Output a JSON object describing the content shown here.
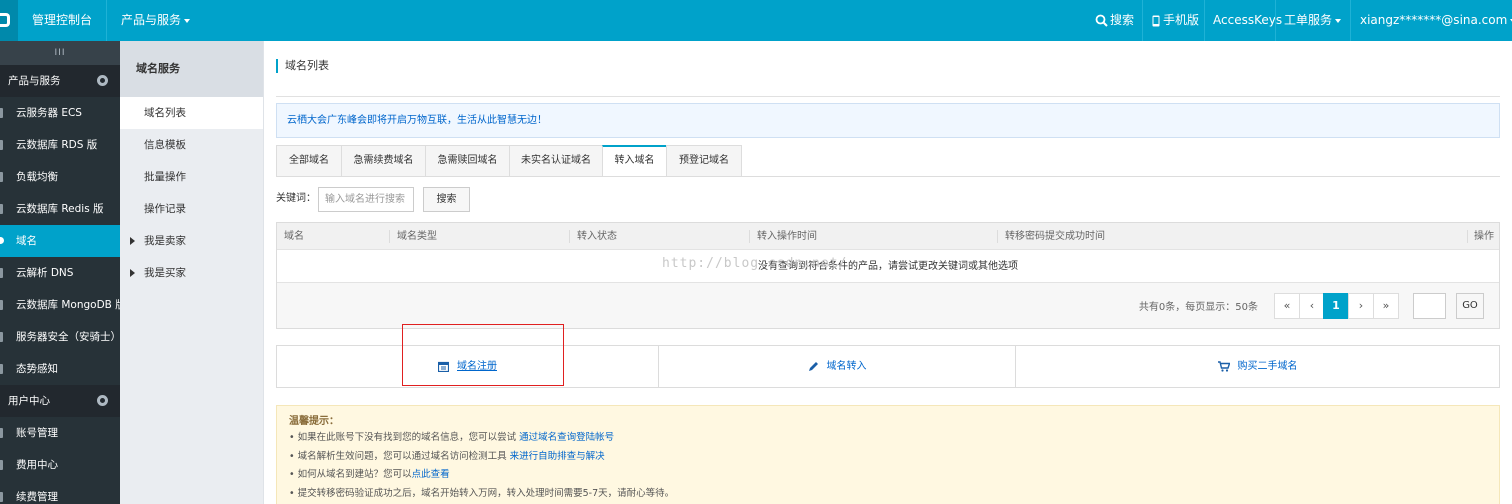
{
  "topbar": {
    "console": "管理控制台",
    "products": "产品与服务",
    "search": "搜索",
    "mobile": "手机版",
    "accesskeys": "AccessKeys",
    "tickets": "工单服务",
    "user": "xiangz*******@sina.com",
    "accent_color": "#00a2ca"
  },
  "sidebar": {
    "toggle": "III",
    "section1": "产品与服务",
    "items": [
      {
        "label": "云服务器 ECS"
      },
      {
        "label": "云数据库 RDS 版"
      },
      {
        "label": "负载均衡"
      },
      {
        "label": "云数据库 Redis 版"
      },
      {
        "label": "域名",
        "active": true
      },
      {
        "label": "云解析 DNS"
      },
      {
        "label": "云数据库 MongoDB 版"
      },
      {
        "label": "服务器安全（安骑士）"
      },
      {
        "label": "态势感知"
      }
    ],
    "section2": "用户中心",
    "items2": [
      {
        "label": "账号管理"
      },
      {
        "label": "费用中心"
      },
      {
        "label": "续费管理"
      }
    ]
  },
  "subnav": {
    "title": "域名服务",
    "items": [
      {
        "label": "域名列表",
        "active": true
      },
      {
        "label": "信息模板"
      },
      {
        "label": "批量操作"
      },
      {
        "label": "操作记录"
      },
      {
        "label": "我是卖家",
        "expandable": true
      },
      {
        "label": "我是买家",
        "expandable": true
      }
    ]
  },
  "main": {
    "title": "域名列表",
    "notice": "云栖大会广东峰会即将开启万物互联，生活从此智慧无边！",
    "tabs": [
      {
        "label": "全部域名"
      },
      {
        "label": "急需续费域名"
      },
      {
        "label": "急需赎回域名"
      },
      {
        "label": "未实名认证域名"
      },
      {
        "label": "转入域名",
        "active": true
      },
      {
        "label": "预登记域名"
      }
    ],
    "keyword_label": "关键词：",
    "keyword_placeholder": "输入域名进行搜索",
    "search_button": "搜索",
    "table": {
      "columns": [
        "域名",
        "域名类型",
        "转入状态",
        "转入操作时间",
        "转移密码提交成功时间",
        "操作"
      ],
      "empty_text": "没有查询到符合条件的产品，请尝试更改关键词或其他选项",
      "watermark": "http://blog.csdn.net/",
      "pager_info": "共有0条，每页显示：50条",
      "pager": [
        "«",
        "‹",
        "1",
        "›",
        "»"
      ],
      "current_page": "1",
      "go": "GO"
    },
    "actions": [
      {
        "label": "域名注册",
        "icon": "calendar-icon"
      },
      {
        "label": "域名转入",
        "icon": "pencil-icon"
      },
      {
        "label": "购买二手域名",
        "icon": "cart-icon"
      }
    ],
    "tips": {
      "title": "温馨提示：",
      "lines": [
        {
          "text": "• 如果在此账号下没有找到您的域名信息，您可以尝试 ",
          "link": "通过域名查询登陆帐号"
        },
        {
          "text": "• 域名解析生效问题，您可以通过域名访问检测工具 ",
          "link": "来进行自助排查与解决"
        },
        {
          "text": "• 如何从域名到建站？您可以",
          "link": "点此查看"
        },
        {
          "text": "• 提交转移密码验证成功之后，域名开始转入万网，转入处理时间需要5-7天，请耐心等待。",
          "link": ""
        }
      ]
    }
  }
}
